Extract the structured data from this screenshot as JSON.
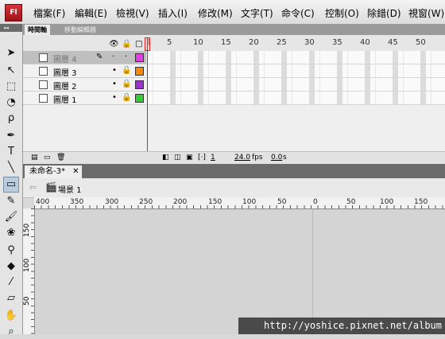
{
  "app": {
    "logo": "Fl"
  },
  "menu": [
    "檔案(F)",
    "編輯(E)",
    "檢視(V)",
    "插入(I)",
    "修改(M)",
    "文字(T)",
    "命令(C)",
    "控制(O)",
    "除錯(D)",
    "視窗(W)"
  ],
  "panel_tabs": [
    "時間軸",
    "移動編輯器"
  ],
  "frame_numbers": [
    "1",
    "5",
    "10",
    "15",
    "20",
    "25",
    "30",
    "35",
    "40",
    "45",
    "50"
  ],
  "layers": [
    {
      "name": "圖層 4",
      "color": "#e040e0",
      "active": true
    },
    {
      "name": "圖層 3",
      "color": "#ff8800",
      "active": false
    },
    {
      "name": "圖層 2",
      "color": "#9933cc",
      "active": false
    },
    {
      "name": "圖層 1",
      "color": "#33cc33",
      "active": false
    }
  ],
  "timeline_footer": {
    "frame": "1",
    "fps": "24.0",
    "fps_unit": "fps",
    "time": "0.0",
    "time_unit": "s"
  },
  "document_tab": "未命名-3*",
  "scene": "場景 1",
  "ruler_top": [
    "400",
    "350",
    "300",
    "250",
    "200",
    "150",
    "100",
    "50",
    "0",
    "50",
    "100",
    "150",
    "200"
  ],
  "ruler_left": [
    "150",
    "100",
    "50"
  ],
  "watermark": "http://yoshice.pixnet.net/album"
}
